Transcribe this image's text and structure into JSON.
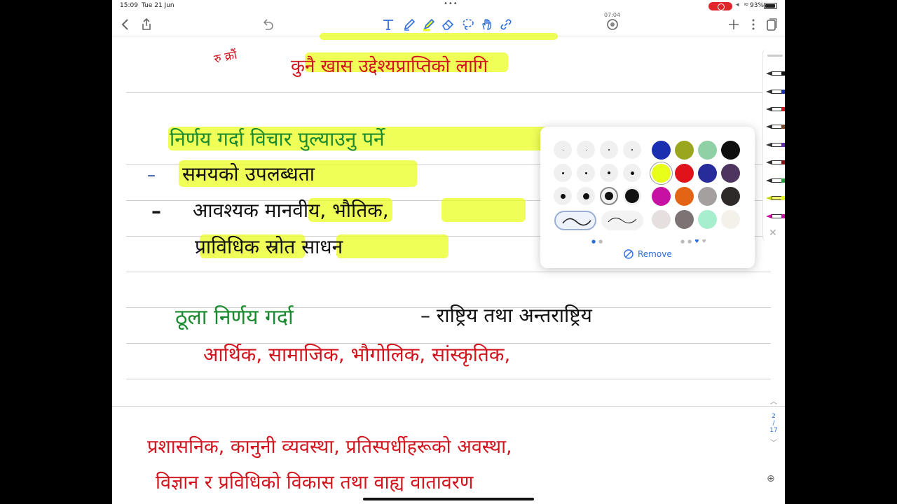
{
  "status": {
    "time": "15:09",
    "date": "Tue 21 Jun",
    "battery": "93%"
  },
  "toolbar": {
    "timer": "07:04",
    "back_icon": "chevron-left-icon",
    "share_icon": "share-icon",
    "undo_icon": "undo-icon",
    "tools": [
      "text-tool-icon",
      "pen-tool-icon",
      "highlighter-tool-icon",
      "eraser-tool-icon",
      "lasso-tool-icon",
      "hand-tool-icon",
      "link-tool-icon"
    ],
    "add_icon": "plus-icon",
    "more_icon": "more-icon",
    "pages_icon": "pages-icon"
  },
  "notes": {
    "line1_partial": "रु क्रौं",
    "line2": "कुनै खास उद्देश्यप्राप्तिको लागि",
    "heading1": "निर्णय गर्दा विचार पुल्याउनु पर्ने",
    "bullet1_marker": "–",
    "bullet1": "समयको उपलब्धता",
    "bullet2_marker": "–",
    "bullet2": "आवश्यक मानवीय, भौतिक,",
    "bullet2_cont": "प्राविधिक स्रोत साधन",
    "heading2_green": "ठूला निर्णय गर्दा",
    "heading2_black": "– राष्ट्रिय तथा अन्तराष्ट्रिय",
    "line_red1": "आर्थिक, सामाजिक, भौगोलिक, सांस्कृतिक,",
    "page2_line1": "प्रशासनिक, कानुनी व्यवस्था, प्रतिस्पर्धीहरूको अवस्था,",
    "page2_line2": "विज्ञान र प्रविधिको विकास तथा वाह्य वातावरण"
  },
  "popover": {
    "remove_label": "Remove",
    "colors": [
      "#1a2fb0",
      "#9aa61e",
      "#8fd0a5",
      "#0e0e0e",
      "#e8ff1a",
      "#e0121a",
      "#272c9a",
      "#4e3560",
      "#c711a2",
      "#e26414",
      "#a4a0a0",
      "#2e2a2a",
      "#e6dfdf",
      "#7c7474",
      "#a7efcc",
      "#f3f1e9"
    ],
    "selected_color_index": 4
  },
  "pagenav": {
    "current": "2",
    "separator": "/",
    "total": "17"
  }
}
